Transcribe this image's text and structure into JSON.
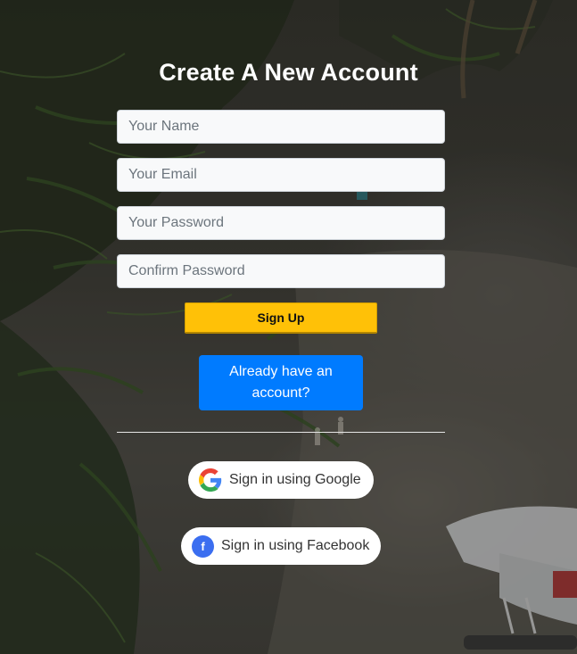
{
  "form": {
    "title": "Create A New Account",
    "name_placeholder": "Your Name",
    "email_placeholder": "Your Email",
    "password_placeholder": "Your Password",
    "confirm_placeholder": "Confirm Password",
    "signup_label": "Sign Up",
    "login_label": "Already have an account?"
  },
  "social": {
    "google_label": "Sign in using Google",
    "facebook_label": "Sign in using Facebook",
    "facebook_glyph": "f"
  },
  "colors": {
    "signup_button": "#ffc107",
    "login_button": "#007bff",
    "facebook_blue": "#3b6ef0"
  },
  "icons": [
    "google-logo-icon",
    "facebook-logo-icon"
  ]
}
